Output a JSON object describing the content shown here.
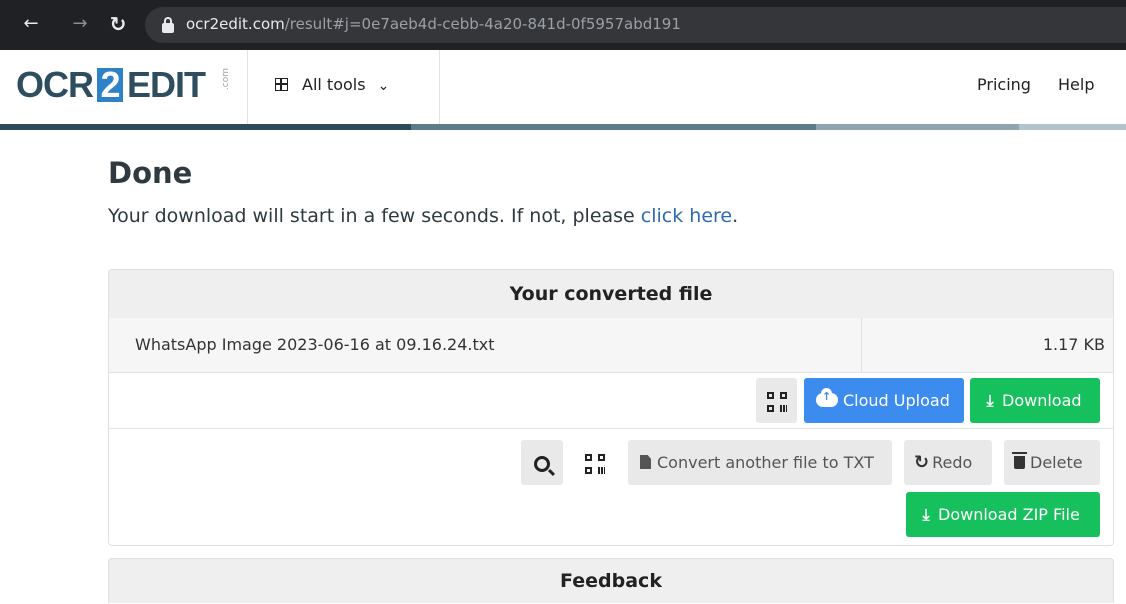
{
  "browser": {
    "url_host": "ocr2edit.com",
    "url_path": "/result#j=0e7aeb4d-cebb-4a20-841d-0f5957abd191"
  },
  "header": {
    "logo": {
      "part1": "OCR",
      "part2": "2",
      "part3": "EDIT",
      "suffix": ".com"
    },
    "all_tools_label": "All tools",
    "pricing_label": "Pricing",
    "help_label": "Help"
  },
  "main": {
    "title": "Done",
    "subtitle_text": "Your download will start in a few seconds. If not, please ",
    "subtitle_link": "click here",
    "subtitle_end": "."
  },
  "converted": {
    "heading": "Your converted file",
    "file_name": "WhatsApp Image 2023-06-16 at 09.16.24.txt",
    "file_size": "1.17 KB",
    "cloud_upload_label": "Cloud Upload",
    "download_label": "Download",
    "convert_another_label": "Convert another file to TXT",
    "redo_label": "Redo",
    "delete_label": "Delete",
    "download_zip_label": "Download ZIP File"
  },
  "feedback": {
    "heading": "Feedback"
  },
  "colors": {
    "blue_button": "#3c8cf0",
    "green_button": "#16c05c",
    "link": "#2e6bb0",
    "browser_bar": "#202124"
  }
}
